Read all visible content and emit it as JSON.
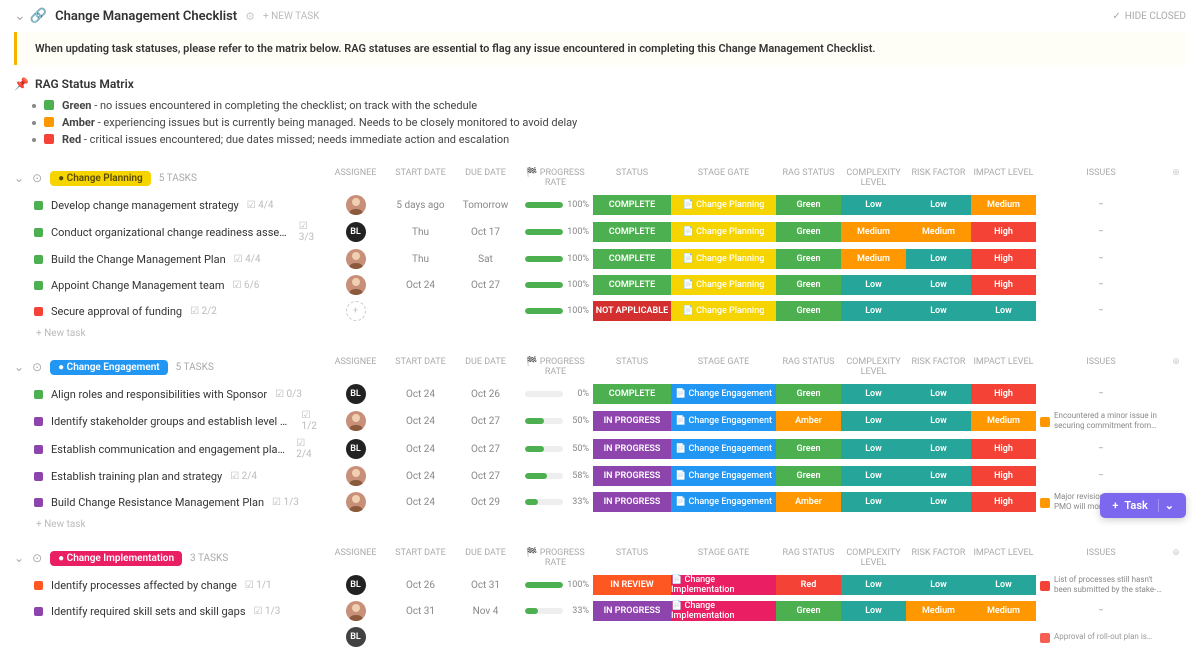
{
  "page": {
    "title": "Change Management Checklist",
    "new_task_btn": "+ NEW TASK",
    "hide_closed": "HIDE CLOSED"
  },
  "banner": "When updating task statuses, please refer to the matrix below. RAG statuses are essential to flag any issue encountered in completing this Change Management Checklist.",
  "rag": {
    "title": "RAG Status Matrix",
    "rows": [
      {
        "color": "green",
        "label": "Green",
        "desc": " - no issues encountered in completing the checklist; on track with the schedule"
      },
      {
        "color": "amber",
        "label": "Amber",
        "desc": " - experiencing issues but is currently being managed. Needs to be closely monitored to avoid delay"
      },
      {
        "color": "red",
        "label": "Red",
        "desc": " - critical issues encountered; due dates missed; needs immediate action and escalation"
      }
    ]
  },
  "columns": {
    "assignee": "ASSIGNEE",
    "start": "START DATE",
    "due": "DUE DATE",
    "progress": "🏁 PROGRESS RATE",
    "status": "STATUS",
    "stage": "STAGE GATE",
    "rag": "RAG STATUS",
    "complexity": "COMPLEXITY LEVEL",
    "risk": "RISK FACTOR",
    "impact": "IMPACT LEVEL",
    "issues": "ISSUES"
  },
  "new_task_row": "+ New task",
  "fab": {
    "label": "Task"
  },
  "groups": [
    {
      "name": "Change Planning",
      "color": "#f5d400",
      "textColor": "#5a4a00",
      "count": "5 TASKS",
      "tasks": [
        {
          "sq": "#4caf50",
          "name": "Develop change management strategy",
          "sub": "4/4",
          "avatar": "f1",
          "start": "5 days ago",
          "due": "Tomorrow",
          "dueCls": "date-due",
          "progress": 100,
          "status": {
            "t": "COMPLETE",
            "c": "#4caf50"
          },
          "stage": {
            "t": "Change Planning",
            "c": "#f5d400"
          },
          "rag": {
            "t": "Green",
            "c": "#4caf50"
          },
          "cx": {
            "t": "Low",
            "c": "#26a69a"
          },
          "risk": {
            "t": "Low",
            "c": "#26a69a"
          },
          "impact": {
            "t": "Medium",
            "c": "#ff9800"
          },
          "issues": "–"
        },
        {
          "sq": "#4caf50",
          "name": "Conduct organizational change readiness assessment",
          "sub": "3/3",
          "avatar": "bl",
          "start": "Thu",
          "due": "Oct 17",
          "dueCls": "date-over",
          "progress": 100,
          "status": {
            "t": "COMPLETE",
            "c": "#4caf50"
          },
          "stage": {
            "t": "Change Planning",
            "c": "#f5d400"
          },
          "rag": {
            "t": "Green",
            "c": "#4caf50"
          },
          "cx": {
            "t": "Medium",
            "c": "#ff9800"
          },
          "risk": {
            "t": "Medium",
            "c": "#ff9800"
          },
          "impact": {
            "t": "High",
            "c": "#f44336"
          },
          "issues": "–"
        },
        {
          "sq": "#4caf50",
          "name": "Build the Change Management Plan",
          "sub": "4/4",
          "avatar": "f1",
          "start": "Thu",
          "due": "Sat",
          "dueCls": "date-due",
          "progress": 100,
          "status": {
            "t": "COMPLETE",
            "c": "#4caf50"
          },
          "stage": {
            "t": "Change Planning",
            "c": "#f5d400"
          },
          "rag": {
            "t": "Green",
            "c": "#4caf50"
          },
          "cx": {
            "t": "Medium",
            "c": "#ff9800"
          },
          "risk": {
            "t": "Low",
            "c": "#26a69a"
          },
          "impact": {
            "t": "High",
            "c": "#f44336"
          },
          "issues": "–"
        },
        {
          "sq": "#4caf50",
          "name": "Appoint Change Management team",
          "sub": "6/6",
          "avatar": "f1",
          "start": "Oct 24",
          "due": "Oct 27",
          "dueCls": "",
          "progress": 100,
          "status": {
            "t": "COMPLETE",
            "c": "#4caf50"
          },
          "stage": {
            "t": "Change Planning",
            "c": "#f5d400"
          },
          "rag": {
            "t": "Green",
            "c": "#4caf50"
          },
          "cx": {
            "t": "Low",
            "c": "#26a69a"
          },
          "risk": {
            "t": "Low",
            "c": "#26a69a"
          },
          "impact": {
            "t": "High",
            "c": "#f44336"
          },
          "issues": "–"
        },
        {
          "sq": "#f44336",
          "name": "Secure approval of funding",
          "sub": "2/2",
          "avatar": "none",
          "start": "",
          "due": "",
          "dueCls": "",
          "progress": 100,
          "status": {
            "t": "NOT APPLICABLE",
            "c": "#d32f2f"
          },
          "stage": {
            "t": "Change Planning",
            "c": "#f5d400"
          },
          "rag": {
            "t": "Green",
            "c": "#4caf50"
          },
          "cx": {
            "t": "Low",
            "c": "#26a69a"
          },
          "risk": {
            "t": "Low",
            "c": "#26a69a"
          },
          "impact": {
            "t": "Low",
            "c": "#26a69a"
          },
          "issues": "–"
        }
      ]
    },
    {
      "name": "Change Engagement",
      "color": "#2196f3",
      "textColor": "#fff",
      "count": "5 TASKS",
      "tasks": [
        {
          "sq": "#4caf50",
          "name": "Align roles and responsibilities with Sponsor",
          "sub": "0/3",
          "avatar": "bl",
          "start": "Oct 24",
          "due": "Oct 26",
          "dueCls": "date-due",
          "progress": 0,
          "status": {
            "t": "COMPLETE",
            "c": "#4caf50"
          },
          "stage": {
            "t": "Change Engagement",
            "c": "#2196f3"
          },
          "rag": {
            "t": "Green",
            "c": "#4caf50"
          },
          "cx": {
            "t": "Low",
            "c": "#26a69a"
          },
          "risk": {
            "t": "Low",
            "c": "#26a69a"
          },
          "impact": {
            "t": "High",
            "c": "#f44336"
          },
          "issues": "–"
        },
        {
          "sq": "#8e44ad",
          "name": "Identify stakeholder groups and establish level of engagement",
          "sub": "1/2",
          "avatar": "f1",
          "start": "Oct 24",
          "due": "Oct 27",
          "dueCls": "",
          "progress": 50,
          "status": {
            "t": "IN PROGRESS",
            "c": "#8e44ad"
          },
          "stage": {
            "t": "Change Engagement",
            "c": "#2196f3"
          },
          "rag": {
            "t": "Amber",
            "c": "#ff9800"
          },
          "cx": {
            "t": "Low",
            "c": "#26a69a"
          },
          "risk": {
            "t": "Low",
            "c": "#26a69a"
          },
          "impact": {
            "t": "Medium",
            "c": "#ff9800"
          },
          "issues": "Encountered a minor issue in securing commitment from…",
          "issColor": "#ff9800"
        },
        {
          "sq": "#8e44ad",
          "name": "Establish communication and engagement plans",
          "sub": "2/4",
          "avatar": "bl",
          "start": "Oct 24",
          "due": "Oct 27",
          "dueCls": "",
          "progress": 50,
          "status": {
            "t": "IN PROGRESS",
            "c": "#8e44ad"
          },
          "stage": {
            "t": "Change Engagement",
            "c": "#2196f3"
          },
          "rag": {
            "t": "Green",
            "c": "#4caf50"
          },
          "cx": {
            "t": "Low",
            "c": "#26a69a"
          },
          "risk": {
            "t": "Low",
            "c": "#26a69a"
          },
          "impact": {
            "t": "High",
            "c": "#f44336"
          },
          "issues": "–"
        },
        {
          "sq": "#8e44ad",
          "name": "Establish training plan and strategy",
          "sub": "2/4",
          "avatar": "f1",
          "start": "Oct 24",
          "due": "Oct 27",
          "dueCls": "",
          "progress": 58,
          "status": {
            "t": "IN PROGRESS",
            "c": "#8e44ad"
          },
          "stage": {
            "t": "Change Engagement",
            "c": "#2196f3"
          },
          "rag": {
            "t": "Green",
            "c": "#4caf50"
          },
          "cx": {
            "t": "Low",
            "c": "#26a69a"
          },
          "risk": {
            "t": "Low",
            "c": "#26a69a"
          },
          "impact": {
            "t": "High",
            "c": "#f44336"
          },
          "issues": "–"
        },
        {
          "sq": "#8e44ad",
          "name": "Build Change Resistance Management Plan",
          "sub": "1/3",
          "avatar": "f1",
          "start": "Oct 24",
          "due": "Oct 29",
          "dueCls": "",
          "progress": 33,
          "status": {
            "t": "IN PROGRESS",
            "c": "#8e44ad"
          },
          "stage": {
            "t": "Change Engagement",
            "c": "#2196f3"
          },
          "rag": {
            "t": "Amber",
            "c": "#ff9800"
          },
          "cx": {
            "t": "Low",
            "c": "#26a69a"
          },
          "risk": {
            "t": "Low",
            "c": "#26a69a"
          },
          "impact": {
            "t": "High",
            "c": "#f44336"
          },
          "issues": "Major revisions are needed. PMO will monitor closely to …",
          "issColor": "#ff9800"
        }
      ]
    },
    {
      "name": "Change Implementation",
      "color": "#e91e63",
      "textColor": "#fff",
      "count": "3 TASKS",
      "tasks": [
        {
          "sq": "#ff5722",
          "name": "Identify processes affected by change",
          "sub": "1/1",
          "avatar": "bl",
          "start": "Oct 26",
          "due": "Oct 31",
          "dueCls": "",
          "progress": 100,
          "status": {
            "t": "IN REVIEW",
            "c": "#ff5722"
          },
          "stage": {
            "t": "Change Implementation",
            "c": "#e91e63"
          },
          "rag": {
            "t": "Red",
            "c": "#f44336"
          },
          "cx": {
            "t": "Low",
            "c": "#26a69a"
          },
          "risk": {
            "t": "Low",
            "c": "#26a69a"
          },
          "impact": {
            "t": "Low",
            "c": "#26a69a"
          },
          "issues": "List of processes still hasn't been submitted by the stake-…",
          "issColor": "#f44336"
        },
        {
          "sq": "#8e44ad",
          "name": "Identify required skill sets and skill gaps",
          "sub": "1/3",
          "avatar": "f1",
          "start": "Oct 31",
          "due": "Nov 4",
          "dueCls": "",
          "progress": 33,
          "status": {
            "t": "IN PROGRESS",
            "c": "#8e44ad"
          },
          "stage": {
            "t": "Change Implementation",
            "c": "#e91e63"
          },
          "rag": {
            "t": "Green",
            "c": "#4caf50"
          },
          "cx": {
            "t": "Low",
            "c": "#26a69a"
          },
          "risk": {
            "t": "Medium",
            "c": "#ff9800"
          },
          "impact": {
            "t": "Medium",
            "c": "#ff9800"
          },
          "issues": "–"
        }
      ],
      "partial": {
        "issues": "Approval of roll-out plan is…",
        "issColor": "#f44336"
      }
    }
  ]
}
